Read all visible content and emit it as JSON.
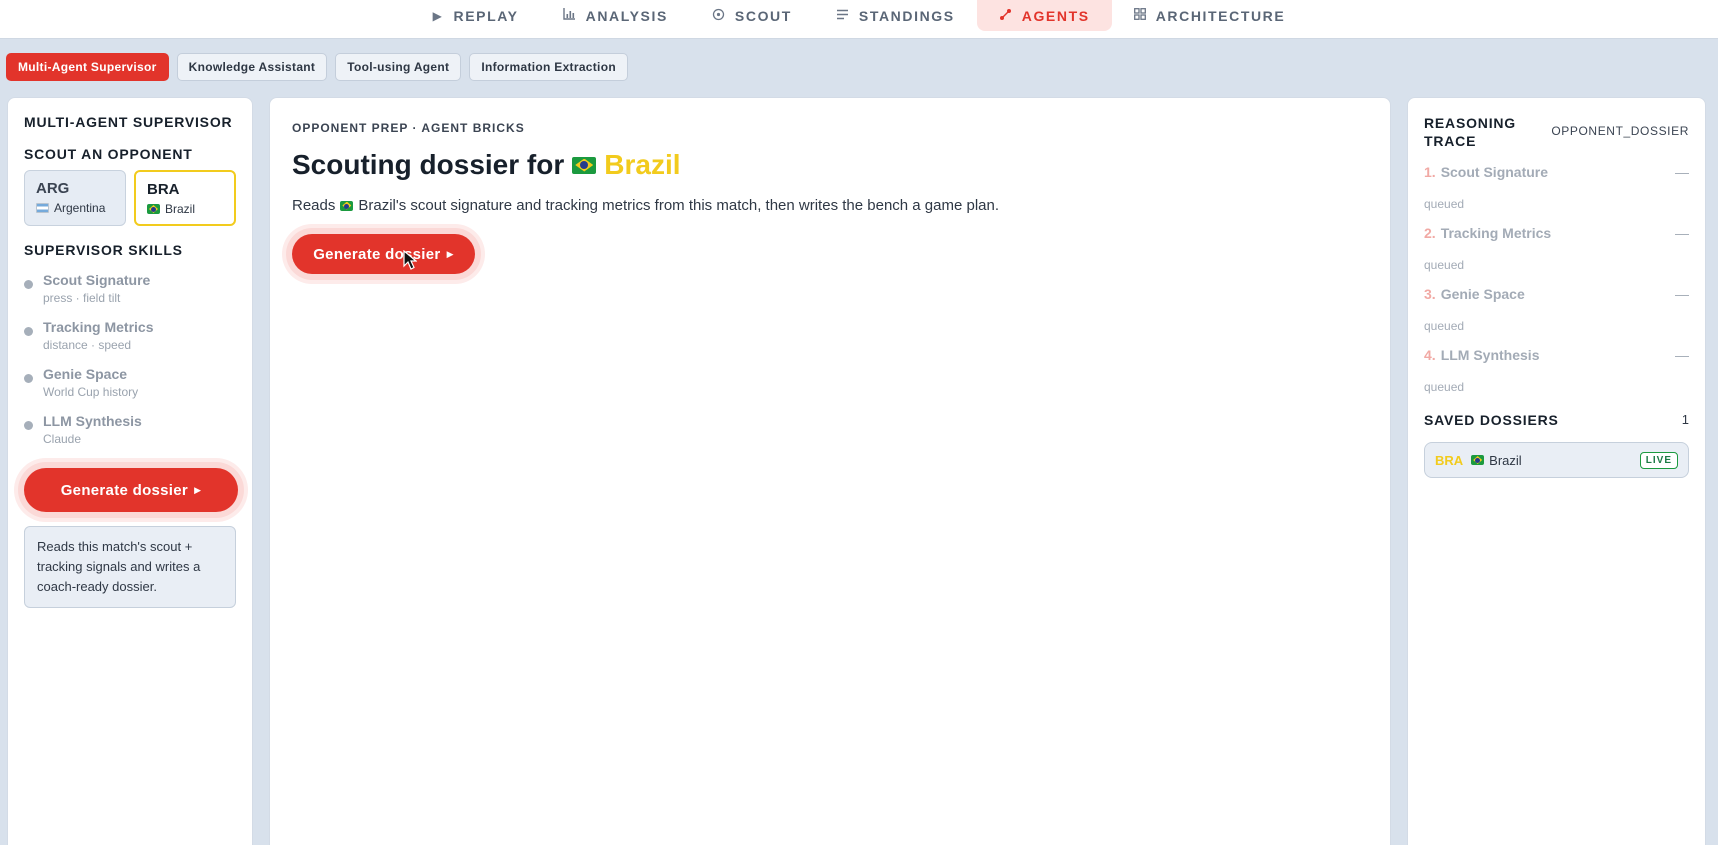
{
  "topnav": {
    "tabs": [
      {
        "label": "REPLAY",
        "icon": "play-icon"
      },
      {
        "label": "ANALYSIS",
        "icon": "bar-chart-icon"
      },
      {
        "label": "SCOUT",
        "icon": "target-icon"
      },
      {
        "label": "STANDINGS",
        "icon": "list-icon"
      },
      {
        "label": "AGENTS",
        "icon": "agents-icon",
        "active": true
      },
      {
        "label": "ARCHITECTURE",
        "icon": "grid-icon"
      }
    ]
  },
  "agent_types": [
    "Multi-Agent Supervisor",
    "Knowledge Assistant",
    "Tool-using Agent",
    "Information Extraction"
  ],
  "left": {
    "title": "MULTI-AGENT SUPERVISOR",
    "scout_label": "SCOUT AN OPPONENT",
    "opponents": [
      {
        "code": "ARG",
        "name": "Argentina"
      },
      {
        "code": "BRA",
        "name": "Brazil",
        "selected": true
      }
    ],
    "skills_label": "SUPERVISOR SKILLS",
    "skills": [
      {
        "name": "Scout Signature",
        "sub": "press · field tilt"
      },
      {
        "name": "Tracking Metrics",
        "sub": "distance · speed"
      },
      {
        "name": "Genie Space",
        "sub": "World Cup history"
      },
      {
        "name": "LLM Synthesis",
        "sub": "Claude"
      }
    ],
    "button": "Generate dossier",
    "info": "Reads this match's scout + tracking signals and writes a coach-ready dossier."
  },
  "center": {
    "eyebrow": "OPPONENT PREP · AGENT BRICKS",
    "headline_prefix": "Scouting dossier for",
    "team": "Brazil",
    "desc_prefix": "Reads",
    "desc_suffix": "Brazil's scout signature and tracking metrics from this match, then writes the bench a game plan.",
    "button": "Generate dossier"
  },
  "right": {
    "title": "REASONING TRACE",
    "tag": "OPPONENT_DOSSIER",
    "steps": [
      {
        "num": "1.",
        "name": "Scout Signature",
        "status": "queued",
        "dash": "—"
      },
      {
        "num": "2.",
        "name": "Tracking Metrics",
        "status": "queued",
        "dash": "—"
      },
      {
        "num": "3.",
        "name": "Genie Space",
        "status": "queued",
        "dash": "—"
      },
      {
        "num": "4.",
        "name": "LLM Synthesis",
        "status": "queued",
        "dash": "—"
      }
    ],
    "saved_label": "SAVED DOSSIERS",
    "saved_count": "1",
    "saved": [
      {
        "code": "BRA",
        "name": "Brazil",
        "badge": "LIVE"
      }
    ]
  },
  "colors": {
    "accent": "#e2342b",
    "brazil_yellow": "#f2cb1d",
    "background": "#d8e1ec"
  }
}
